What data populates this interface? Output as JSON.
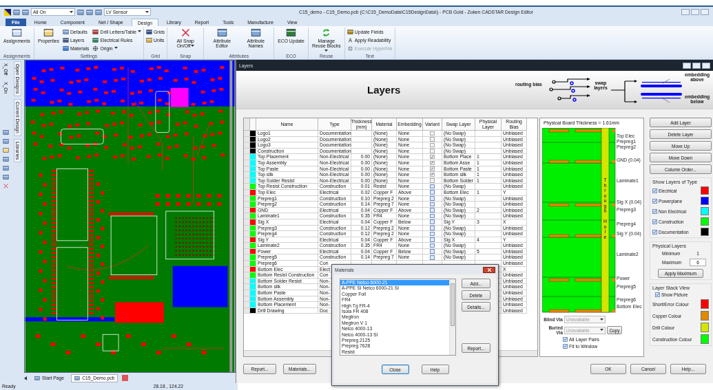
{
  "window": {
    "title": "C15_demo - C15_Demo.pcb (C:\\C15_DemoData\\C15DesignData\\) - PCB Gold - Zuken CADSTAR Design Editor"
  },
  "quick_access": {
    "layer_combo": "All On",
    "variant_combo": "LV Sensor"
  },
  "menu_tabs": [
    {
      "label": "File",
      "kind": "file",
      "selected": false
    },
    {
      "label": "Home",
      "kind": "tab",
      "selected": false
    },
    {
      "label": "Component",
      "kind": "tab",
      "selected": false
    },
    {
      "label": "Net / Shape",
      "kind": "tab",
      "selected": false
    },
    {
      "label": "Design",
      "kind": "tab",
      "selected": true
    },
    {
      "label": "Library",
      "kind": "tab",
      "selected": false
    },
    {
      "label": "Report",
      "kind": "tab",
      "selected": false
    },
    {
      "label": "Tools",
      "kind": "tab",
      "selected": false
    },
    {
      "label": "Manufacture",
      "kind": "tab",
      "selected": false
    },
    {
      "label": "View",
      "kind": "tab",
      "selected": false
    }
  ],
  "ribbon": {
    "groups": [
      {
        "label": "Assignments",
        "items": [
          {
            "label": "Assignments",
            "kind": "large",
            "dropdown": false
          }
        ]
      },
      {
        "label": "Settings",
        "items": [
          {
            "label": "Properties",
            "kind": "large",
            "dropdown": false
          },
          {
            "label": "Defaults",
            "kind": "small",
            "dropdown": false
          },
          {
            "label": "Layers",
            "kind": "small",
            "dropdown": false
          },
          {
            "label": "Materials",
            "kind": "small",
            "dropdown": false
          },
          {
            "label": "Drill Letters/Table",
            "kind": "small",
            "dropdown": true
          },
          {
            "label": "Electrical Rules",
            "kind": "small",
            "dropdown": false
          },
          {
            "label": "Origin",
            "kind": "small",
            "dropdown": true
          }
        ]
      },
      {
        "label": "Grid",
        "items": [
          {
            "label": "Grids",
            "kind": "small",
            "dropdown": false
          },
          {
            "label": "Units",
            "kind": "small",
            "dropdown": false
          }
        ]
      },
      {
        "label": "Snap",
        "items": [
          {
            "label": "All Snap On/Off",
            "kind": "large",
            "dropdown": true
          }
        ]
      },
      {
        "label": "Attributes",
        "items": [
          {
            "label": "Attribute Editor",
            "kind": "large",
            "dropdown": false
          },
          {
            "label": "Attribute Names",
            "kind": "large",
            "dropdown": false
          }
        ]
      },
      {
        "label": "ECO",
        "items": [
          {
            "label": "ECO Update",
            "kind": "large",
            "dropdown": false
          }
        ]
      },
      {
        "label": "Reuse",
        "items": [
          {
            "label": "Manage Reuse Blocks",
            "kind": "large",
            "dropdown": true
          }
        ]
      },
      {
        "label": "Text",
        "items": [
          {
            "label": "Update Fields",
            "kind": "small",
            "dropdown": false,
            "disabled": false
          },
          {
            "label": "Apply Readability",
            "kind": "small",
            "dropdown": false,
            "disabled": false
          },
          {
            "label": "Execute Hyperlink",
            "kind": "small",
            "dropdown": false,
            "disabled": true
          }
        ]
      }
    ]
  },
  "side_tabs": [
    "Open Designs",
    "Current Design",
    "Libraries"
  ],
  "side_labels": [
    "X_Off",
    "X_On"
  ],
  "doc_tabs": [
    {
      "label": "Start Page",
      "selected": false
    },
    {
      "label": "C15_Demo.pcb",
      "selected": true
    }
  ],
  "status_bar": {
    "text": "Ready",
    "coordinates": "28.18 , 124.22"
  },
  "layers_dialog": {
    "title": "Layers",
    "heading": "Layers",
    "legend": {
      "routing_bias": "routing bias",
      "swap_layers": "swap layers",
      "embedding_above": "embedding above",
      "embedding_below": "embedding below"
    },
    "table": {
      "columns": [
        "Name",
        "Type",
        "Thickness (mm)",
        "Material",
        "Embedding",
        "Variant",
        "Swap Layer",
        "Physical Layer",
        "Routing Bias"
      ],
      "rows": [
        {
          "name": "Logo1",
          "color": "#000000",
          "type": "Documentation",
          "material": "(None)",
          "embedding": "None",
          "variant": {
            "checked": false,
            "disabled": true
          },
          "swap_layer": "(No Swap)",
          "routing_bias": "Unbiased"
        },
        {
          "name": "Logo2",
          "color": "#000000",
          "type": "Documentation",
          "material": "(None)",
          "embedding": "None",
          "variant": {
            "checked": false,
            "disabled": true
          },
          "swap_layer": "(No Swap)",
          "routing_bias": "Unbiased"
        },
        {
          "name": "Logo3",
          "color": "#000000",
          "type": "Documentation",
          "material": "(None)",
          "embedding": "None",
          "variant": {
            "checked": false,
            "disabled": true
          },
          "swap_layer": "(No Swap)",
          "routing_bias": "Unbiased"
        },
        {
          "name": "Construction",
          "color": "#000000",
          "type": "Documentation",
          "material": "(None)",
          "embedding": "None",
          "variant": {
            "checked": false,
            "disabled": true
          },
          "swap_layer": "(No Swap)",
          "routing_bias": "Unbiased"
        },
        {
          "name": "Top Placement",
          "color": "#00ffff",
          "type": "Non-Electrical",
          "thickness": "0.00",
          "material": "(None)",
          "embedding": "None",
          "variant": {
            "checked": true,
            "disabled": true
          },
          "swap_layer": "Bottom Place",
          "physical_layer": "1",
          "routing_bias": "Unbiased"
        },
        {
          "name": "Top Assembly",
          "color": "#00ffff",
          "type": "Non-Electrical",
          "thickness": "0.00",
          "material": "(None)",
          "embedding": "None",
          "variant": {
            "checked": true,
            "disabled": true
          },
          "swap_layer": "Bottom Asse",
          "physical_layer": "1",
          "routing_bias": "Unbiased"
        },
        {
          "name": "Top Paste",
          "color": "#00ffff",
          "type": "Non-Electrical",
          "thickness": "0.00",
          "material": "(None)",
          "embedding": "None",
          "variant": {
            "checked": true,
            "disabled": true
          },
          "swap_layer": "Bottom Paste",
          "physical_layer": "1",
          "routing_bias": "Unbiased"
        },
        {
          "name": "Top silk",
          "color": "#00ffff",
          "type": "Non-Electrical",
          "thickness": "0.00",
          "material": "(None)",
          "embedding": "None",
          "variant": {
            "checked": true,
            "disabled": true
          },
          "swap_layer": "Bottom silk",
          "physical_layer": "1",
          "routing_bias": "Unbiased"
        },
        {
          "name": "Top Solder Resist",
          "color": "#00ffff",
          "type": "Non-Electrical",
          "thickness": "0.00",
          "material": "(None)",
          "embedding": "None",
          "variant": {
            "checked": false,
            "disabled": true
          },
          "swap_layer": "Bottom Solder",
          "physical_layer": "1",
          "routing_bias": "Unbiased"
        },
        {
          "name": "Top Resist Construction",
          "color": "#00ff00",
          "type": "Construction",
          "thickness": "0.01",
          "material": "Resist",
          "embedding": "None",
          "variant": {
            "checked": false,
            "disabled": false
          },
          "swap_layer": "(No Swap)",
          "routing_bias": "Unbiased"
        },
        {
          "name": "Top Elec",
          "color": "#ff0000",
          "type": "Electrical",
          "thickness": "0.02",
          "material": "Copper F",
          "embedding": "Above",
          "variant": {
            "checked": false,
            "disabled": false
          },
          "swap_layer": "Bottom Elec",
          "physical_layer": "1",
          "routing_bias": "Y"
        },
        {
          "name": "Prepreg1",
          "color": "#00ff00",
          "type": "Construction",
          "thickness": "0.10",
          "material": "Prepreg 2",
          "embedding": "None",
          "variant": {
            "checked": false,
            "disabled": false
          },
          "swap_layer": "(No Swap)",
          "routing_bias": "Unbiased"
        },
        {
          "name": "Prepreg2",
          "color": "#00ff00",
          "type": "Construction",
          "thickness": "0.14",
          "material": "Prepreg 7",
          "embedding": "None",
          "variant": {
            "checked": false,
            "disabled": false
          },
          "swap_layer": "(No Swap)",
          "routing_bias": "Unbiased"
        },
        {
          "name": "GND",
          "color": "#ff0000",
          "type": "Electrical",
          "thickness": "0.04",
          "material": "Copper F",
          "embedding": "Above",
          "variant": {
            "checked": false,
            "disabled": false
          },
          "swap_layer": "(No Swap)",
          "physical_layer": "2",
          "routing_bias": "Unbiased"
        },
        {
          "name": "Laminate1",
          "color": "#00ff00",
          "type": "Construction",
          "thickness": "0.35",
          "material": "FR4",
          "embedding": "None",
          "variant": {
            "checked": false,
            "disabled": false
          },
          "swap_layer": "(No Swap)",
          "routing_bias": "Unbiased"
        },
        {
          "name": "Sig X",
          "color": "#ff0000",
          "type": "Electrical",
          "thickness": "0.04",
          "material": "Copper F",
          "embedding": "Below",
          "variant": {
            "checked": false,
            "disabled": false
          },
          "swap_layer": "Sig Y",
          "physical_layer": "3",
          "routing_bias": "X"
        },
        {
          "name": "Prepreg3",
          "color": "#00ff00",
          "type": "Construction",
          "thickness": "0.12",
          "material": "Prepreg 2",
          "embedding": "None",
          "variant": {
            "checked": false,
            "disabled": false
          },
          "swap_layer": "(No Swap)",
          "routing_bias": "Unbiased"
        },
        {
          "name": "Prepreg4",
          "color": "#00ff00",
          "type": "Construction",
          "thickness": "0.12",
          "material": "Prepreg 2",
          "embedding": "None",
          "variant": {
            "checked": false,
            "disabled": false
          },
          "swap_layer": "(No Swap)",
          "routing_bias": "Unbiased"
        },
        {
          "name": "Sig Y",
          "color": "#ff0000",
          "type": "Electrical",
          "thickness": "0.04",
          "material": "Copper F",
          "embedding": "Above",
          "variant": {
            "checked": false,
            "disabled": false
          },
          "swap_layer": "Sig X",
          "physical_layer": "4",
          "routing_bias": "Y"
        },
        {
          "name": "Laminate2",
          "color": "#00ff00",
          "type": "Construction",
          "thickness": "0.35",
          "material": "FR4",
          "embedding": "None",
          "variant": {
            "checked": false,
            "disabled": false
          },
          "swap_layer": "(No Swap)",
          "routing_bias": "Unbiased"
        },
        {
          "name": "Power",
          "color": "#ff0000",
          "type": "Electrical",
          "thickness": "0.04",
          "material": "Copper F",
          "embedding": "Below",
          "variant": {
            "checked": false,
            "disabled": false
          },
          "swap_layer": "(No Swap)",
          "physical_layer": "5",
          "routing_bias": "Unbiased"
        },
        {
          "name": "Prepreg5",
          "color": "#00ff00",
          "type": "Construction",
          "thickness": "0.14",
          "material": "Prepreg 7",
          "embedding": "None",
          "variant": {
            "checked": false,
            "disabled": false
          },
          "swap_layer": "(No Swap)",
          "routing_bias": "Unbiased"
        },
        {
          "name": "Prepreg6",
          "color": "#00ff00",
          "type": "Con",
          "routing_bias": "Unbiased"
        },
        {
          "name": "Bottom Elec",
          "color": "#ff0000",
          "type": "Elect",
          "routing_bias": "X"
        },
        {
          "name": "Bottom Resist Construction",
          "color": "#00ff00",
          "type": "Con",
          "routing_bias": "Unbiased"
        },
        {
          "name": "Bottom Solder Resist",
          "color": "#00ffff",
          "type": "Non-",
          "routing_bias": "Unbiased"
        },
        {
          "name": "Bottom silk",
          "color": "#00ffff",
          "type": "Non-",
          "routing_bias": "Unbiased"
        },
        {
          "name": "Bottom Paste",
          "color": "#00ffff",
          "type": "Non-",
          "routing_bias": "Unbiased"
        },
        {
          "name": "Bottom Assembly",
          "color": "#00ffff",
          "type": "Non-",
          "routing_bias": "Unbiased"
        },
        {
          "name": "Bottom Placement",
          "color": "#00ffff",
          "type": "Non-",
          "routing_bias": "Unbiased"
        },
        {
          "name": "Drill Drawing",
          "color": "#000000",
          "type": "Doc",
          "routing_bias": "Unbiased"
        }
      ]
    },
    "stack_view": {
      "title": "Physical Board Thickness = 1.61mm",
      "through_hole_label": "Through Hole",
      "layer_labels": [
        "Top Elec",
        "Prepreg1",
        "Prepreg2",
        "GND (0.04)",
        "Laminate1",
        "Sig X (0.04)",
        "Prepreg3",
        "Prepreg4",
        "Sig Y (0.04)",
        "Laminate2",
        "Power",
        "Prepreg5",
        "Prepreg6",
        "Bottom Elec"
      ],
      "blind_via": {
        "label": "Blind Via",
        "value": "Unavailable",
        "disabled": true
      },
      "buried_via": {
        "label": "Buried Via",
        "value": "Unavailable",
        "disabled": true
      },
      "copy_button": "Copy",
      "options": [
        {
          "label": "All Layer Pairs",
          "checked": true
        },
        {
          "label": "Fit to Window",
          "checked": true
        }
      ]
    },
    "side_buttons": [
      "Add Layer",
      "Delete Layer",
      "Move Up",
      "Move Down",
      "Column Order..."
    ],
    "show_layers_of_type": {
      "title": "Show Layers of Type",
      "items": [
        {
          "label": "Electrical",
          "checked": true,
          "color": "#ff0000"
        },
        {
          "label": "Powerplane",
          "checked": true,
          "color": "#0000ff"
        },
        {
          "label": "Non Electrical",
          "checked": true,
          "color": "#00ffff"
        },
        {
          "label": "Construction",
          "checked": true,
          "color": "#00ff00"
        },
        {
          "label": "Documentation",
          "checked": true,
          "color": "#000000"
        }
      ]
    },
    "physical_layers": {
      "title": "Physical Layers",
      "minimum_label": "Minimum",
      "minimum": "1",
      "maximum_label": "Maximum",
      "maximum": "6",
      "apply_button": "Apply Maximum"
    },
    "layer_stack_view": {
      "title": "Layer Stack View",
      "show_picture": {
        "label": "Show Picture",
        "checked": true
      },
      "colours": [
        {
          "label": "Short/Error Colour",
          "color": "#ff0000"
        },
        {
          "label": "Copper Colour",
          "color": "#e08a00"
        },
        {
          "label": "Drill Colour",
          "color": "#d4e600"
        },
        {
          "label": "Construction Colour",
          "color": "#00ff00"
        }
      ]
    },
    "footer_left": [
      "Report...",
      "Materials..."
    ],
    "footer_right": [
      "OK",
      "Cancel",
      "Help..."
    ]
  },
  "materials_dialog": {
    "title": "Materials",
    "items": [
      {
        "label": "A-PPE Nelco 6000-21",
        "selected": true
      },
      {
        "label": "A-PPE SI Nelco 6000-21 SI",
        "selected": false
      },
      {
        "label": "Copper Foil",
        "selected": false
      },
      {
        "label": "FR4",
        "selected": false
      },
      {
        "label": "High Tg FR-4",
        "selected": false
      },
      {
        "label": "Isola FR 408",
        "selected": false
      },
      {
        "label": "Megtron",
        "selected": false
      },
      {
        "label": "Megtron V 1",
        "selected": false
      },
      {
        "label": "Nelco 4000-13",
        "selected": false
      },
      {
        "label": "Nelco 4000-13 SI",
        "selected": false
      },
      {
        "label": "Prepreg 2125",
        "selected": false
      },
      {
        "label": "Prepreg 7628",
        "selected": false
      },
      {
        "label": "Resist",
        "selected": false
      }
    ],
    "buttons": [
      "Add...",
      "Delete",
      "Details...",
      "Report..."
    ],
    "footer_buttons": [
      {
        "label": "Close",
        "default": true
      },
      {
        "label": "Help",
        "default": false
      }
    ]
  }
}
